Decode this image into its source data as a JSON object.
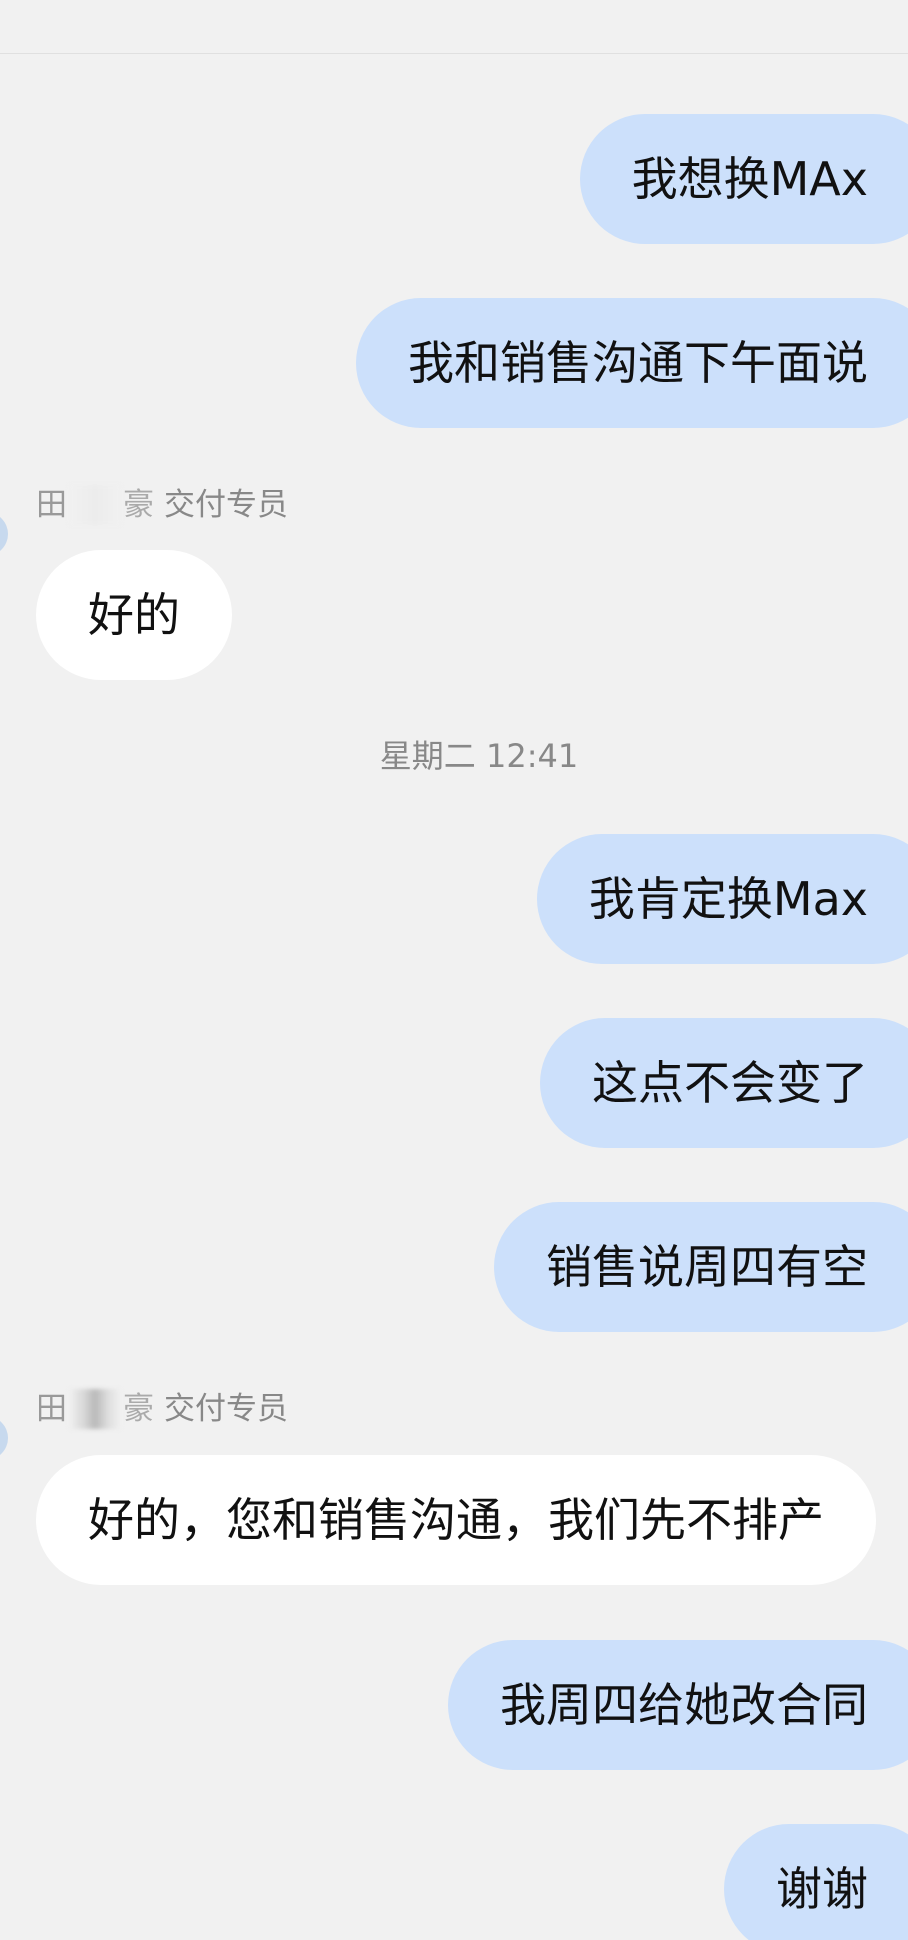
{
  "messages": [
    {
      "side": "out",
      "text": "我想换MAx"
    },
    {
      "side": "out",
      "text": "我和销售沟通下午面说"
    },
    {
      "side": "in",
      "sender_surname": "田",
      "sender_tail": "豪",
      "sender_role": "交付专员",
      "text": "好的"
    },
    {
      "side": "out",
      "text": "我肯定换Max"
    },
    {
      "side": "out",
      "text": "这点不会变了"
    },
    {
      "side": "out",
      "text": "销售说周四有空"
    },
    {
      "side": "in",
      "sender_surname": "田",
      "sender_tail": "豪",
      "sender_role": "交付专员",
      "text": "好的，您和销售沟通，我们先不排产"
    },
    {
      "side": "out",
      "text": "我周四给她改合同"
    },
    {
      "side": "out",
      "text": "谢谢"
    }
  ],
  "timestamp": "星期二 12:41",
  "colors": {
    "background": "#f1f1f1",
    "outgoing_bubble": "#cce0fb",
    "incoming_bubble": "#ffffff",
    "meta_text": "#888888"
  }
}
